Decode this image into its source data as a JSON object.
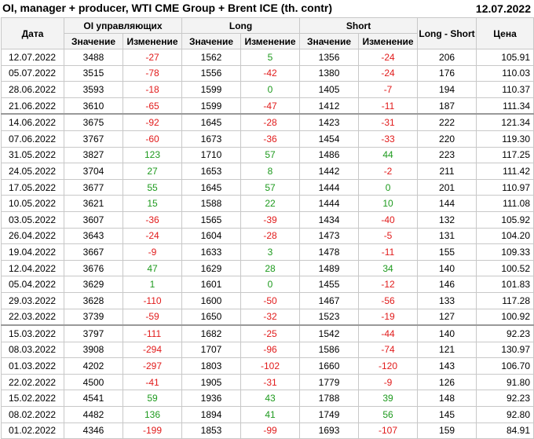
{
  "title": "OI, manager + producer, WTI CME Group + Brent ICE (th. contr)",
  "report_date": "12.07.2022",
  "headers": {
    "date": "Дата",
    "oi_group": "OI управляющих",
    "long_group": "Long",
    "short_group": "Short",
    "long_short": "Long - Short",
    "price": "Цена",
    "value": "Значение",
    "change": "Изменение"
  },
  "colors": {
    "positive": "#1e9a1e",
    "negative": "#e11b1b"
  },
  "rows": [
    [
      "12.07.2022",
      "3488",
      "-27",
      "1562",
      "5",
      "1356",
      "-24",
      "206",
      "105.91"
    ],
    [
      "05.07.2022",
      "3515",
      "-78",
      "1556",
      "-42",
      "1380",
      "-24",
      "176",
      "110.03"
    ],
    [
      "28.06.2022",
      "3593",
      "-18",
      "1599",
      "0",
      "1405",
      "-7",
      "194",
      "110.37"
    ],
    [
      "21.06.2022",
      "3610",
      "-65",
      "1599",
      "-47",
      "1412",
      "-11",
      "187",
      "111.34"
    ],
    [
      "14.06.2022",
      "3675",
      "-92",
      "1645",
      "-28",
      "1423",
      "-31",
      "222",
      "121.34"
    ],
    [
      "07.06.2022",
      "3767",
      "-60",
      "1673",
      "-36",
      "1454",
      "-33",
      "220",
      "119.30"
    ],
    [
      "31.05.2022",
      "3827",
      "123",
      "1710",
      "57",
      "1486",
      "44",
      "223",
      "117.25"
    ],
    [
      "24.05.2022",
      "3704",
      "27",
      "1653",
      "8",
      "1442",
      "-2",
      "211",
      "111.42"
    ],
    [
      "17.05.2022",
      "3677",
      "55",
      "1645",
      "57",
      "1444",
      "0",
      "201",
      "110.97"
    ],
    [
      "10.05.2022",
      "3621",
      "15",
      "1588",
      "22",
      "1444",
      "10",
      "144",
      "111.08"
    ],
    [
      "03.05.2022",
      "3607",
      "-36",
      "1565",
      "-39",
      "1434",
      "-40",
      "132",
      "105.92"
    ],
    [
      "26.04.2022",
      "3643",
      "-24",
      "1604",
      "-28",
      "1473",
      "-5",
      "131",
      "104.20"
    ],
    [
      "19.04.2022",
      "3667",
      "-9",
      "1633",
      "3",
      "1478",
      "-11",
      "155",
      "109.33"
    ],
    [
      "12.04.2022",
      "3676",
      "47",
      "1629",
      "28",
      "1489",
      "34",
      "140",
      "100.52"
    ],
    [
      "05.04.2022",
      "3629",
      "1",
      "1601",
      "0",
      "1455",
      "-12",
      "146",
      "101.83"
    ],
    [
      "29.03.2022",
      "3628",
      "-110",
      "1600",
      "-50",
      "1467",
      "-56",
      "133",
      "117.28"
    ],
    [
      "22.03.2022",
      "3739",
      "-59",
      "1650",
      "-32",
      "1523",
      "-19",
      "127",
      "100.92"
    ],
    [
      "15.03.2022",
      "3797",
      "-111",
      "1682",
      "-25",
      "1542",
      "-44",
      "140",
      "92.23"
    ],
    [
      "08.03.2022",
      "3908",
      "-294",
      "1707",
      "-96",
      "1586",
      "-74",
      "121",
      "130.97"
    ],
    [
      "01.03.2022",
      "4202",
      "-297",
      "1803",
      "-102",
      "1660",
      "-120",
      "143",
      "106.70"
    ],
    [
      "22.02.2022",
      "4500",
      "-41",
      "1905",
      "-31",
      "1779",
      "-9",
      "126",
      "91.80"
    ],
    [
      "15.02.2022",
      "4541",
      "59",
      "1936",
      "43",
      "1788",
      "39",
      "148",
      "92.23"
    ],
    [
      "08.02.2022",
      "4482",
      "136",
      "1894",
      "41",
      "1749",
      "56",
      "145",
      "92.80"
    ],
    [
      "01.02.2022",
      "4346",
      "-199",
      "1853",
      "-99",
      "1693",
      "-107",
      "159",
      "84.91"
    ]
  ]
}
